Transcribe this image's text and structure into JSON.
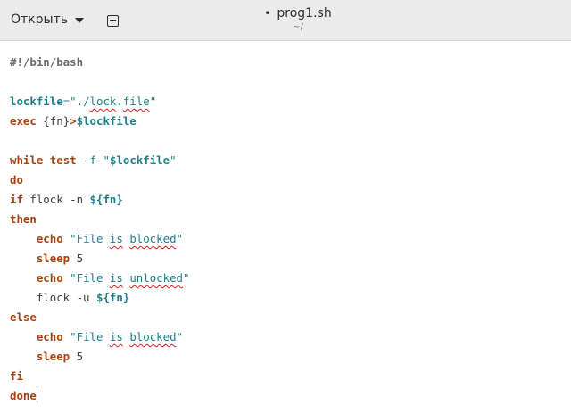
{
  "header": {
    "open_label": "Открыть",
    "modified_marker": "•",
    "title": "prog1.sh",
    "subtitle": "~/"
  },
  "editor": {
    "lines": {
      "l1": {
        "a": "#!/bin/bash"
      },
      "l3": {
        "a": "lockfile",
        "b": "=\"./",
        "c": "lock",
        "d": ".",
        "e": "file",
        "f": "\""
      },
      "l4": {
        "a": "exec",
        "b": " {fn}",
        "c": ">",
        "d": "$lockfile"
      },
      "l6": {
        "a": "while",
        "b": " ",
        "c": "test",
        "d": " ",
        "e": "-f",
        "f": " \"",
        "g": "$lockfile",
        "h": "\""
      },
      "l7": {
        "a": "do"
      },
      "l8": {
        "a": "if",
        "b": " flock -n ",
        "c": "${fn}"
      },
      "l9": {
        "a": "then"
      },
      "l10": {
        "a": "    ",
        "b": "echo",
        "c": " \"",
        "d": "File",
        "e": " ",
        "f": "is",
        "g": " ",
        "h": "blocked",
        "i": "\""
      },
      "l11": {
        "a": "    ",
        "b": "sleep",
        "c": " 5"
      },
      "l12": {
        "a": "    ",
        "b": "echo",
        "c": " \"",
        "d": "File",
        "e": " ",
        "f": "is",
        "g": " ",
        "h": "unlocked",
        "i": "\""
      },
      "l13": {
        "a": "    flock -u ",
        "b": "${fn}"
      },
      "l14": {
        "a": "else"
      },
      "l15": {
        "a": "    ",
        "b": "echo",
        "c": " \"",
        "d": "File",
        "e": " ",
        "f": "is",
        "g": " ",
        "h": "blocked",
        "i": "\""
      },
      "l16": {
        "a": "    ",
        "b": "sleep",
        "c": " 5"
      },
      "l17": {
        "a": "fi"
      },
      "l18": {
        "a": "done"
      }
    }
  },
  "colors": {
    "keyword": "#a4410e",
    "variable": "#1c7f8c",
    "string": "#1c7f8c",
    "spellcheck": "#d42323",
    "header_bg": "#ebebeb"
  },
  "icons": {
    "open_dropdown": "caret-down-icon",
    "new_tab": "new-document-icon"
  }
}
